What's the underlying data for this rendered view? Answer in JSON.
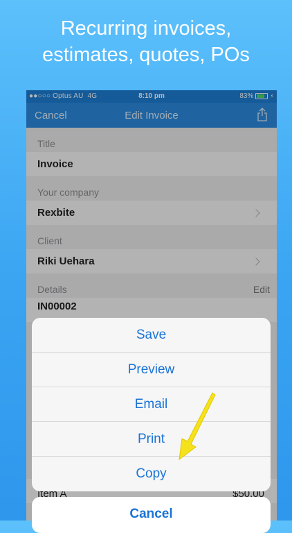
{
  "headline": {
    "line1": "Recurring invoices,",
    "line2": "estimates, quotes, POs"
  },
  "status_bar": {
    "carrier": "●●○○○ Optus AU",
    "network": "4G",
    "time": "8:10 pm",
    "battery": "83%"
  },
  "nav_bar": {
    "cancel_label": "Cancel",
    "title": "Edit Invoice",
    "share_icon": "share-icon"
  },
  "form": {
    "title_label": "Title",
    "title_value": "Invoice",
    "company_label": "Your company",
    "company_value": "Rexbite",
    "client_label": "Client",
    "client_value": "Riki Uehara",
    "details_label": "Details",
    "details_edit": "Edit",
    "details_value": "IN00002",
    "item_name": "Item A",
    "item_price": "$50.00"
  },
  "action_sheet": {
    "items": [
      {
        "label": "Save"
      },
      {
        "label": "Preview"
      },
      {
        "label": "Email"
      },
      {
        "label": "Print"
      },
      {
        "label": "Copy"
      }
    ],
    "cancel_label": "Cancel"
  },
  "colors": {
    "background_top": "#5cc0fb",
    "nav_bar": "#2b8be0",
    "action_text": "#1a73d6",
    "arrow": "#f5e21a"
  }
}
